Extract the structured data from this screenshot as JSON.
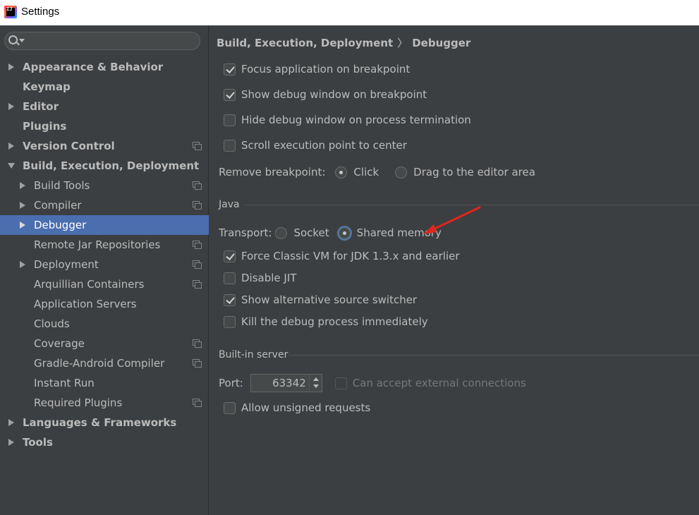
{
  "window": {
    "title": "Settings",
    "icon": "intellij-app-icon",
    "icon_text": "IJ"
  },
  "search": {
    "placeholder": ""
  },
  "sidebar": {
    "items": [
      {
        "label": "Appearance & Behavior",
        "expander": "collapsed",
        "bold": true,
        "project": false
      },
      {
        "label": "Keymap",
        "expander": "none",
        "bold": true,
        "project": false
      },
      {
        "label": "Editor",
        "expander": "collapsed",
        "bold": true,
        "project": false
      },
      {
        "label": "Plugins",
        "expander": "none",
        "bold": true,
        "project": false
      },
      {
        "label": "Version Control",
        "expander": "collapsed",
        "bold": true,
        "project": true
      },
      {
        "label": "Build, Execution, Deployment",
        "expander": "expanded",
        "bold": true,
        "project": false
      },
      {
        "label": "Build Tools",
        "expander": "collapsed",
        "bold": false,
        "project": true
      },
      {
        "label": "Compiler",
        "expander": "collapsed",
        "bold": false,
        "project": true
      },
      {
        "label": "Debugger",
        "expander": "collapsed",
        "bold": false,
        "project": false,
        "selected": true
      },
      {
        "label": "Remote Jar Repositories",
        "expander": "none",
        "bold": false,
        "project": true
      },
      {
        "label": "Deployment",
        "expander": "collapsed",
        "bold": false,
        "project": true
      },
      {
        "label": "Arquillian Containers",
        "expander": "none",
        "bold": false,
        "project": true
      },
      {
        "label": "Application Servers",
        "expander": "none",
        "bold": false,
        "project": false
      },
      {
        "label": "Clouds",
        "expander": "none",
        "bold": false,
        "project": false
      },
      {
        "label": "Coverage",
        "expander": "none",
        "bold": false,
        "project": true
      },
      {
        "label": "Gradle-Android Compiler",
        "expander": "none",
        "bold": false,
        "project": true
      },
      {
        "label": "Instant Run",
        "expander": "none",
        "bold": false,
        "project": false
      },
      {
        "label": "Required Plugins",
        "expander": "none",
        "bold": false,
        "project": true
      },
      {
        "label": "Languages & Frameworks",
        "expander": "collapsed",
        "bold": true,
        "project": false
      },
      {
        "label": "Tools",
        "expander": "collapsed",
        "bold": true,
        "project": false
      }
    ]
  },
  "breadcrumb": {
    "parent": "Build, Execution, Deployment",
    "separator": "〉",
    "current": "Debugger"
  },
  "general": {
    "focus_on_breakpoint": {
      "label": "Focus application on breakpoint",
      "checked": true
    },
    "show_debug_window": {
      "label": "Show debug window on breakpoint",
      "checked": true
    },
    "hide_debug_window": {
      "label": "Hide debug window on process termination",
      "checked": false
    },
    "scroll_exec_point": {
      "label": "Scroll execution point to center",
      "checked": false
    },
    "remove_breakpoint": {
      "label": "Remove breakpoint:",
      "options": [
        {
          "label": "Click",
          "selected": true
        },
        {
          "label": "Drag to the editor area",
          "selected": false
        }
      ]
    }
  },
  "java": {
    "section_title": "Java",
    "transport": {
      "label": "Transport:",
      "options": [
        {
          "label": "Socket",
          "selected": false
        },
        {
          "label": "Shared memory",
          "selected": true
        }
      ]
    },
    "force_classic_vm": {
      "label": "Force Classic VM for JDK 1.3.x and earlier",
      "checked": true
    },
    "disable_jit": {
      "label": "Disable JIT",
      "checked": false
    },
    "show_alt_source": {
      "label": "Show alternative source switcher",
      "checked": true
    },
    "kill_debug_process": {
      "label": "Kill the debug process immediately",
      "checked": false
    }
  },
  "builtin_server": {
    "section_title": "Built-in server",
    "port": {
      "label": "Port:",
      "value": "63342"
    },
    "accept_external": {
      "label": "Can accept external connections",
      "checked": false,
      "enabled": false
    },
    "allow_unsigned": {
      "label": "Allow unsigned requests",
      "checked": false
    }
  },
  "colors": {
    "background": "#3c3f41",
    "selection": "#4b6eaf",
    "text": "#bbbbbb",
    "annotation_arrow": "#e0261e"
  }
}
